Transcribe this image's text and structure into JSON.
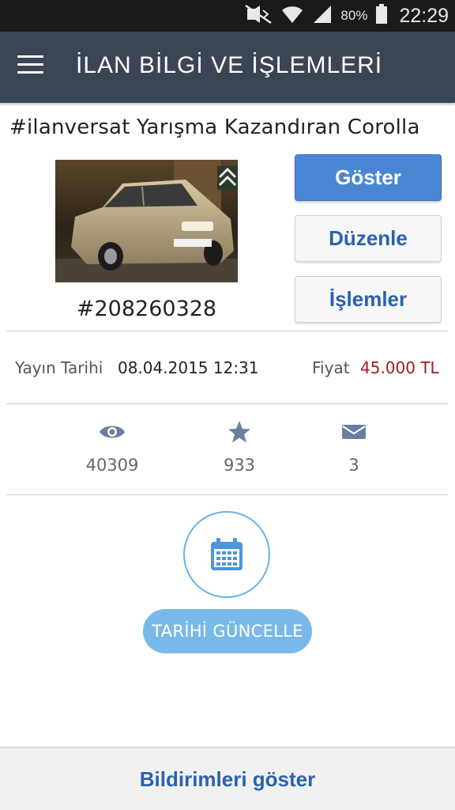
{
  "status_bar": {
    "battery": "80%",
    "time": "22:29",
    "icons": [
      "mute-icon",
      "wifi-icon",
      "signal-icon",
      "battery-icon"
    ]
  },
  "app_bar": {
    "menu_icon": "hamburger-menu-icon",
    "title": "İLAN BİLGİ VE İŞLEMLERİ"
  },
  "listing": {
    "title": "#ilanversat Yarışma Kazandıran Corolla",
    "id": "#208260328",
    "photo": "car-photo"
  },
  "actions": {
    "show": "Göster",
    "edit": "Düzenle",
    "operations": "İşlemler"
  },
  "info": {
    "publish_label": "Yayın Tarihi",
    "publish_value": "08.04.2015 12:31",
    "price_label": "Fiyat",
    "price_value": "45.000 TL"
  },
  "stats": [
    {
      "icon": "eye-icon",
      "value": "40309"
    },
    {
      "icon": "star-icon",
      "value": "933"
    },
    {
      "icon": "envelope-icon",
      "value": "3"
    }
  ],
  "update": {
    "icon": "calendar-icon",
    "label": "TARİHİ GÜNCELLE"
  },
  "bottom_bar": {
    "label": "Bildirimleri göster"
  },
  "colors": {
    "app_bar": "#3a4556",
    "primary_button": "#4a86d4",
    "link_blue": "#2a62ad",
    "price_red": "#9e1b1b",
    "accent_light_blue": "#78b9ea"
  }
}
